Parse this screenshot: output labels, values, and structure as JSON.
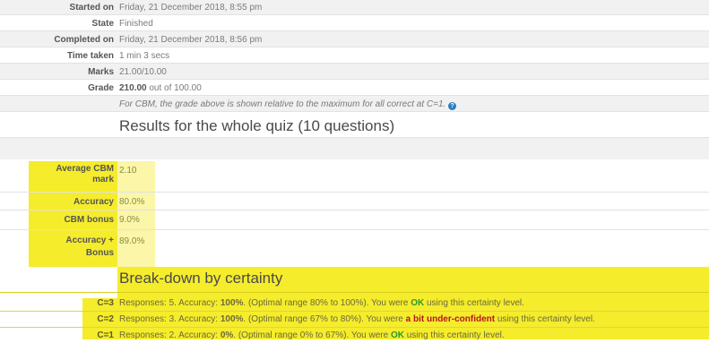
{
  "summary": [
    {
      "label": "Started on",
      "value": "Friday, 21 December 2018, 8:55 pm"
    },
    {
      "label": "State",
      "value": "Finished"
    },
    {
      "label": "Completed on",
      "value": "Friday, 21 December 2018, 8:56 pm"
    },
    {
      "label": "Time taken",
      "value": "1 min 3 secs"
    },
    {
      "label": "Marks",
      "value": "21.00/10.00"
    },
    {
      "label": "Grade",
      "value_bold": "210.00",
      "value_rest": " out of 100.00"
    }
  ],
  "cbm_note": "For CBM, the grade above is shown relative to the maximum for all correct at C=1.",
  "whole_quiz": {
    "heading": "Results for the whole quiz (10 questions)",
    "rows": [
      {
        "label_line1": "Average CBM",
        "label_line2": "mark",
        "value": "2.10"
      },
      {
        "label": "Accuracy",
        "value": "80.0%"
      },
      {
        "label": "CBM bonus",
        "value": "9.0%"
      },
      {
        "label_line1": "Accuracy +",
        "label_line2": "Bonus",
        "value": "89.0%"
      }
    ]
  },
  "breakdown": {
    "heading": "Break-down by certainty",
    "rows": [
      {
        "label": "C=3",
        "part1": "Responses: 5. Accuracy: ",
        "accuracy": "100%",
        "part2": ". (Optimal range 80% to 100%). You were ",
        "verdict": "OK",
        "part3": " using this certainty level."
      },
      {
        "label": "C=2",
        "part1": "Responses: 3. Accuracy: ",
        "accuracy": "100%",
        "part2": ". (Optimal range 67% to 80%). You were ",
        "verdict": "a bit under-confident",
        "part3": " using this certainty level."
      },
      {
        "label": "C=1",
        "part1": "Responses: 2. Accuracy: ",
        "accuracy": "0%",
        "part2": ". (Optimal range 0% to 67%). You were ",
        "verdict": "OK",
        "part3": " using this certainty level."
      }
    ]
  },
  "colors": {
    "highlight": "#f5ec2c",
    "ok": "#2b9a2b",
    "under_confident": "#b8141d",
    "info": "#2a7fc4"
  },
  "icons": {
    "help": "info-icon"
  }
}
